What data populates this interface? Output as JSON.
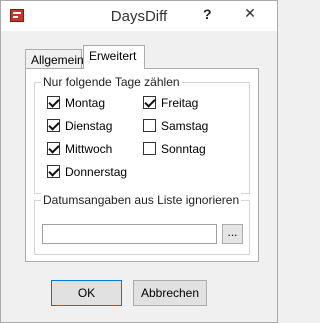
{
  "window": {
    "title": "DaysDiff",
    "help_label": "?",
    "close_label": "✕"
  },
  "tabs": [
    {
      "label": "Allgemein",
      "active": false
    },
    {
      "label": "Erweitert",
      "active": true
    }
  ],
  "days_group": {
    "legend": "Nur folgende Tage zählen",
    "days": [
      {
        "label": "Montag",
        "checked": true
      },
      {
        "label": "Dienstag",
        "checked": true
      },
      {
        "label": "Mittwoch",
        "checked": true
      },
      {
        "label": "Donnerstag",
        "checked": true
      },
      {
        "label": "Freitag",
        "checked": true
      },
      {
        "label": "Samstag",
        "checked": false
      },
      {
        "label": "Sonntag",
        "checked": false
      }
    ]
  },
  "list_group": {
    "legend": "Datumsangaben aus Liste ignorieren",
    "input_value": "",
    "browse_label": "..."
  },
  "buttons": {
    "ok": "OK",
    "cancel": "Abbrechen"
  }
}
